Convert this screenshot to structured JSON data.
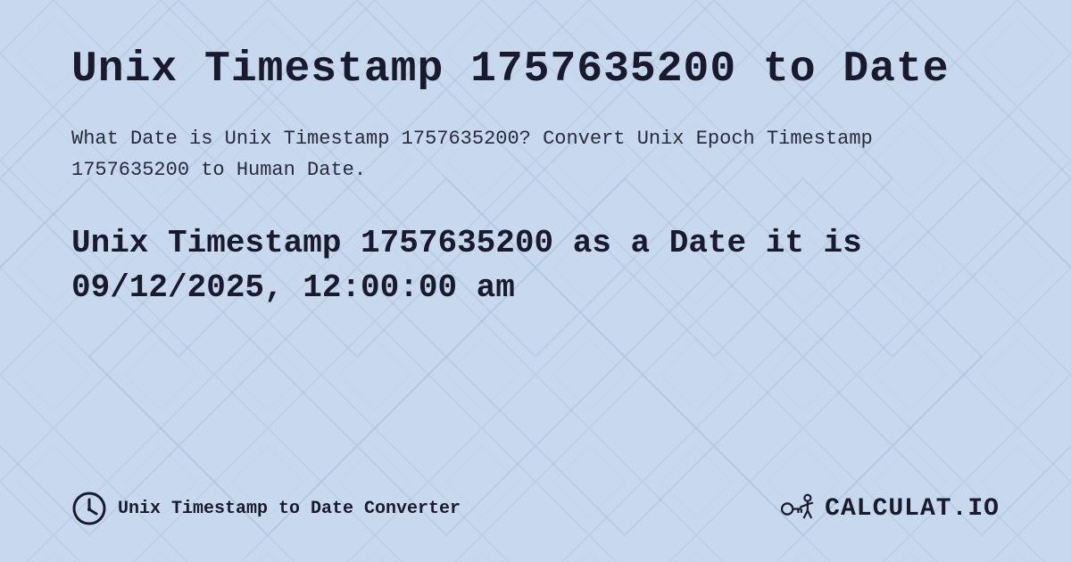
{
  "background": {
    "color": "#c8d8ee",
    "pattern_color_light": "#d4e3f5",
    "pattern_color_dark": "#b8cce0"
  },
  "header": {
    "title": "Unix Timestamp 1757635200 to Date"
  },
  "description": {
    "text": "What Date is Unix Timestamp 1757635200? Convert Unix Epoch Timestamp 1757635200 to Human Date."
  },
  "result": {
    "text": "Unix Timestamp 1757635200 as a Date it is 09/12/2025, 12:00:00 am"
  },
  "footer": {
    "link_text": "Unix Timestamp to Date Converter",
    "logo_text": "CALCULAT.IO"
  },
  "icons": {
    "clock": "clock-icon",
    "logo_figure": "calculat-logo-icon"
  }
}
